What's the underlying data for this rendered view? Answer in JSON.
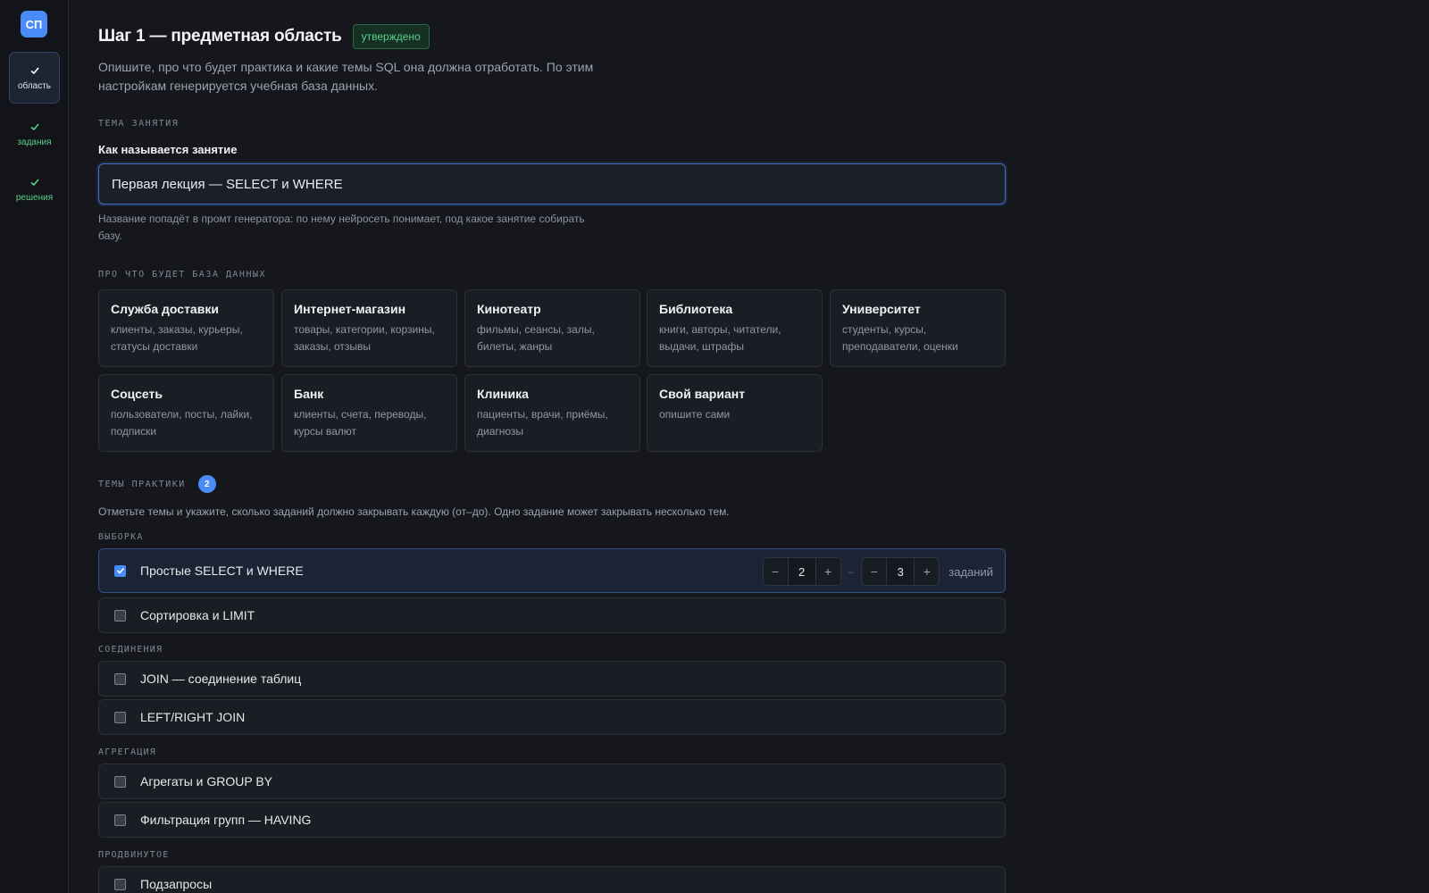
{
  "sidebar": {
    "logo": "СП",
    "steps": [
      {
        "label": "область",
        "state": "active"
      },
      {
        "label": "задания",
        "state": "done"
      },
      {
        "label": "решения",
        "state": "done"
      }
    ]
  },
  "header": {
    "title": "Шаг 1 — предметная область",
    "badge": "утверждено",
    "intro": "Опишите, про что будет практика и какие темы SQL она должна отработать. По этим настройкам генерируется учебная база данных."
  },
  "session": {
    "section_label": "ТЕМА ЗАНЯТИЯ",
    "field_label": "Как называется занятие",
    "value": "Первая лекция — SELECT и WHERE",
    "hint": "Название попадёт в промт генератора: по нему нейросеть понимает, под какое занятие собирать базу."
  },
  "domains": {
    "section_label": "ПРО ЧТО БУДЕТ БАЗА ДАННЫХ",
    "cards": [
      {
        "title": "Служба доставки",
        "desc": "клиенты, заказы, курьеры, статусы доставки"
      },
      {
        "title": "Интернет-магазин",
        "desc": "товары, категории, корзины, заказы, отзывы"
      },
      {
        "title": "Кинотеатр",
        "desc": "фильмы, сеансы, залы, билеты, жанры"
      },
      {
        "title": "Библиотека",
        "desc": "книги, авторы, читатели, выдачи, штрафы"
      },
      {
        "title": "Университет",
        "desc": "студенты, курсы, преподаватели, оценки"
      },
      {
        "title": "Соцсеть",
        "desc": "пользователи, посты, лайки, подписки"
      },
      {
        "title": "Банк",
        "desc": "клиенты, счета, переводы, курсы валют"
      },
      {
        "title": "Клиника",
        "desc": "пациенты, врачи, приёмы, диагнозы"
      },
      {
        "title": "Свой вариант",
        "desc": "опишите сами"
      }
    ]
  },
  "topics": {
    "section_label": "ТЕМЫ ПРАКТИКИ",
    "count": "2",
    "description": "Отметьте темы и укажите, сколько заданий должно закрывать каждую (от–до). Одно задание может закрывать несколько тем.",
    "groups": [
      {
        "label": "ВЫБОРКА",
        "items": [
          {
            "label": "Простые SELECT и WHERE",
            "checked": true,
            "min": "2",
            "max": "3",
            "unit": "заданий"
          },
          {
            "label": "Сортировка и LIMIT",
            "checked": false
          }
        ]
      },
      {
        "label": "СОЕДИНЕНИЯ",
        "items": [
          {
            "label": "JOIN — соединение таблиц",
            "checked": false
          },
          {
            "label": "LEFT/RIGHT JOIN",
            "checked": false
          }
        ]
      },
      {
        "label": "АГРЕГАЦИЯ",
        "items": [
          {
            "label": "Агрегаты и GROUP BY",
            "checked": false
          },
          {
            "label": "Фильтрация групп — HAVING",
            "checked": false
          }
        ]
      },
      {
        "label": "ПРОДВИНУТОЕ",
        "items": [
          {
            "label": "Подзапросы",
            "checked": false
          }
        ]
      }
    ],
    "stepper_minus": "−",
    "stepper_plus": "+",
    "range_dash": "–"
  },
  "colors": {
    "accent": "#4a8cf7",
    "success": "#5bd08a",
    "background": "#15171c"
  }
}
